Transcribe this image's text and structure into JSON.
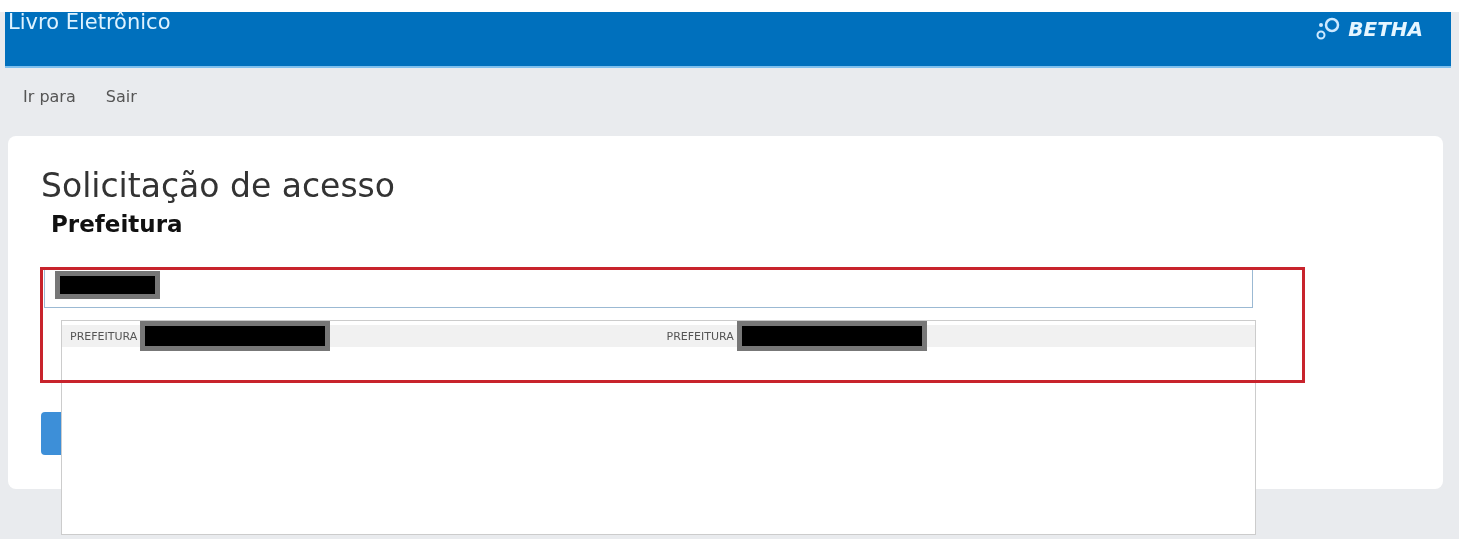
{
  "header": {
    "title": "Livro Eletrônico",
    "logo_text": "BETHA"
  },
  "nav": [
    {
      "label": "Ir para"
    },
    {
      "label": "Sair"
    }
  ],
  "card": {
    "title": "Solicitação de acesso",
    "section": "Prefeitura",
    "field": {
      "redacted": true
    },
    "dropdown": {
      "options": [
        {
          "label": "PREFEITURA",
          "redacted": true,
          "highlighted": true
        },
        {
          "label": "PREFEITURA",
          "redacted": true,
          "highlighted": true
        }
      ]
    }
  }
}
